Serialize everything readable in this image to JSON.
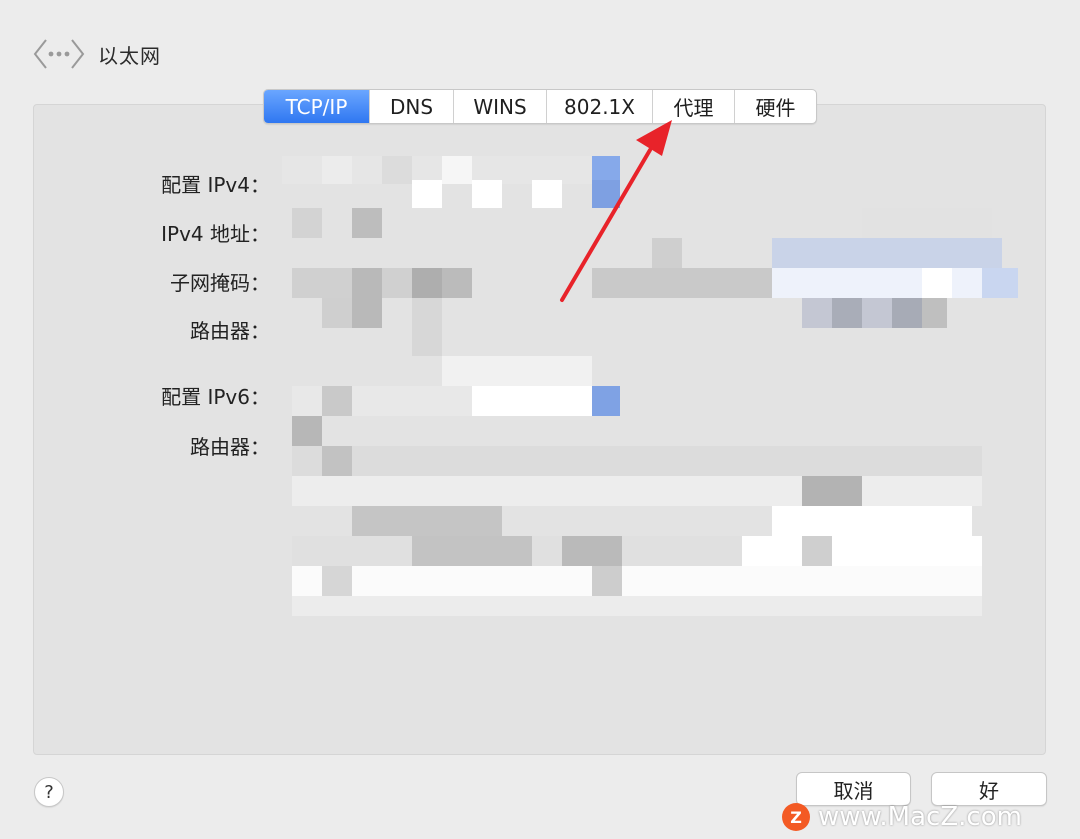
{
  "header": {
    "title": "以太网",
    "nav_icon": "network-dots-icon"
  },
  "tabs": [
    {
      "label": "TCP/IP",
      "active": true
    },
    {
      "label": "DNS",
      "active": false
    },
    {
      "label": "WINS",
      "active": false
    },
    {
      "label": "802.1X",
      "active": false
    },
    {
      "label": "代理",
      "active": false
    },
    {
      "label": "硬件",
      "active": false
    }
  ],
  "fields": {
    "config_ipv4": "配置 IPv4：",
    "ipv4_address": "IPv4 地址：",
    "subnet_mask": "子网掩码：",
    "router_v4": "路由器：",
    "config_ipv6": "配置 IPv6：",
    "router_v6": "路由器："
  },
  "buttons": {
    "help": "?",
    "cancel": "取消",
    "ok": "好"
  },
  "colors": {
    "accent": "#2f77f1",
    "annotation_arrow": "#e8232a"
  },
  "watermark": {
    "logo_letter": "Z",
    "text": "www.MacZ.com"
  }
}
